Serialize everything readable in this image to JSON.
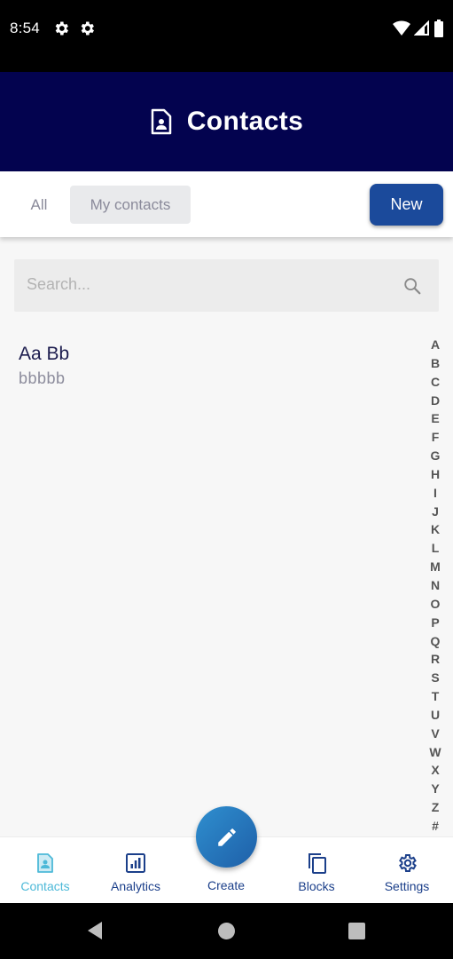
{
  "status_bar": {
    "time": "8:54",
    "left_icons": [
      "gear-icon",
      "gear-icon"
    ],
    "right_icons": [
      "wifi-icon",
      "signal-icon",
      "battery-icon"
    ]
  },
  "header": {
    "title": "Contacts",
    "icon": "contact-document-icon",
    "background": "#03034f"
  },
  "filter": {
    "tabs": [
      {
        "label": "All",
        "selected": false
      },
      {
        "label": "My contacts",
        "selected": true
      }
    ],
    "new_label": "New"
  },
  "search": {
    "placeholder": "Search...",
    "value": ""
  },
  "contacts": [
    {
      "name": "Aa Bb",
      "detail": "bbbbb"
    }
  ],
  "alphabet": [
    "A",
    "B",
    "C",
    "D",
    "E",
    "F",
    "G",
    "H",
    "I",
    "J",
    "K",
    "L",
    "M",
    "N",
    "O",
    "P",
    "Q",
    "R",
    "S",
    "T",
    "U",
    "V",
    "W",
    "X",
    "Y",
    "Z",
    "#"
  ],
  "bottom_nav": {
    "items": [
      {
        "label": "Contacts",
        "icon": "contacts-icon",
        "active": true
      },
      {
        "label": "Analytics",
        "icon": "analytics-icon",
        "active": false
      },
      {
        "label": "Create",
        "icon": "pencil-icon",
        "active": false
      },
      {
        "label": "Blocks",
        "icon": "blocks-icon",
        "active": false
      },
      {
        "label": "Settings",
        "icon": "settings-icon",
        "active": false
      }
    ]
  },
  "colors": {
    "accent": "#1b4a9b",
    "active_nav": "#4db9d8",
    "nav_text": "#1b3f8a"
  }
}
